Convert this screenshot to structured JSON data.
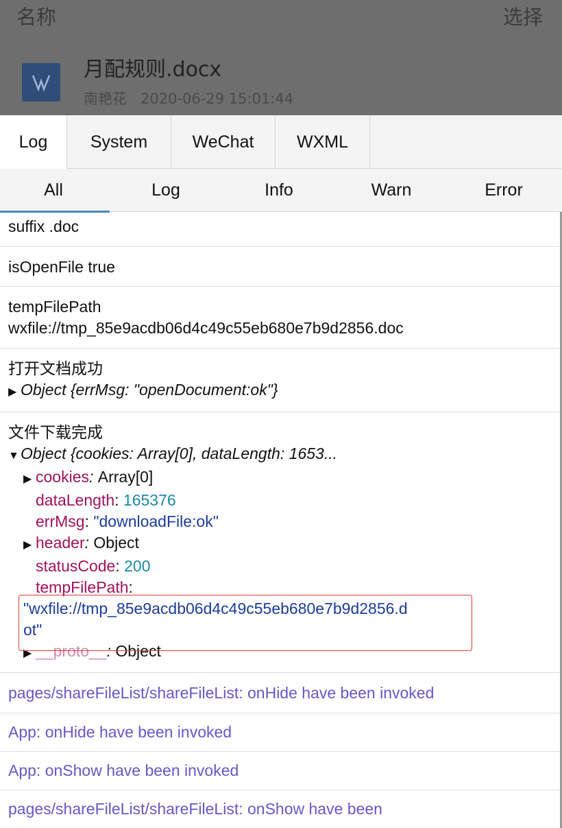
{
  "background": {
    "col_name": "名称",
    "col_select": "选择",
    "file": {
      "name": "月配规则.docx",
      "owner": "南艳花",
      "date": "2020-06-29 15:01:44",
      "icon": "word-doc-icon"
    }
  },
  "tabs": [
    "Log",
    "System",
    "WeChat",
    "WXML"
  ],
  "filters": [
    "All",
    "Log",
    "Info",
    "Warn",
    "Error"
  ],
  "logs": {
    "e1": "suffix .doc",
    "e2": "isOpenFile true",
    "e3_line1": "tempFilePath",
    "e3_line2": "wxfile://tmp_85e9acdb06d4c49c55eb680e7b9d2856.doc",
    "e4_title": "打开文档成功",
    "e4_obj": "Object {errMsg: \"openDocument:ok\"}",
    "e5_title": "文件下载完成",
    "e5_obj": "Object {cookies: Array[0], dataLength: 1653...",
    "e5_props": {
      "cookies_key": "cookies",
      "cookies_val": "Array[0]",
      "dataLength_key": "dataLength",
      "dataLength_val": "165376",
      "errMsg_key": "errMsg",
      "errMsg_val": "\"downloadFile:ok\"",
      "header_key": "header",
      "header_val": "Object",
      "statusCode_key": "statusCode",
      "statusCode_val": "200",
      "tempFilePath_key": "tempFilePath",
      "tempFilePath_val_line1": "\"wxfile://tmp_85e9acdb06d4c49c55eb680e7b9d2856.d",
      "tempFilePath_val_line2": "ot\"",
      "proto_key": "__proto__",
      "proto_val": "Object"
    },
    "e6": "pages/shareFileList/shareFileList: onHide have been invoked",
    "e7": "App: onHide have been invoked",
    "e8": "App: onShow have been invoked",
    "e9": "pages/shareFileList/shareFileList: onShow have been"
  },
  "colors": {
    "highlight_box": "#e03a3a",
    "active_filter_underline": "#4a86c8",
    "lifecycle_text": "#6b55c8"
  }
}
